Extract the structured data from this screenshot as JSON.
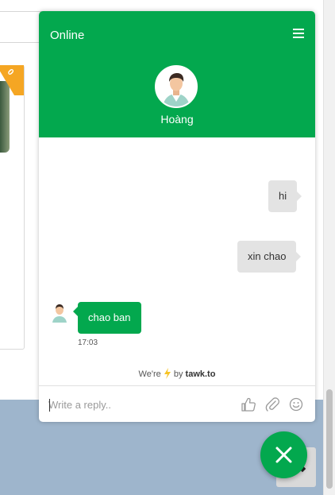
{
  "background": {
    "ribbon_text": "0"
  },
  "chat": {
    "status": "Online",
    "agent_name": "Hoàng",
    "messages": [
      {
        "from": "user",
        "text": "hi"
      },
      {
        "from": "user",
        "text": "xin chao"
      },
      {
        "from": "agent",
        "text": "chao ban",
        "time": "17:03"
      }
    ],
    "powered_by": {
      "prefix": "We're",
      "mid": "by",
      "brand": "tawk.to"
    },
    "input_placeholder": "Write a reply..",
    "icons": {
      "menu": "hamburger-icon",
      "like": "thumbs-up-icon",
      "attach": "paperclip-icon",
      "emoji": "smiley-icon",
      "close": "close-icon",
      "bolt": "lightning-icon"
    },
    "colors": {
      "brand": "#03a84e",
      "bubble_user": "#e3e3e3",
      "bolt": "#f7c325"
    }
  }
}
